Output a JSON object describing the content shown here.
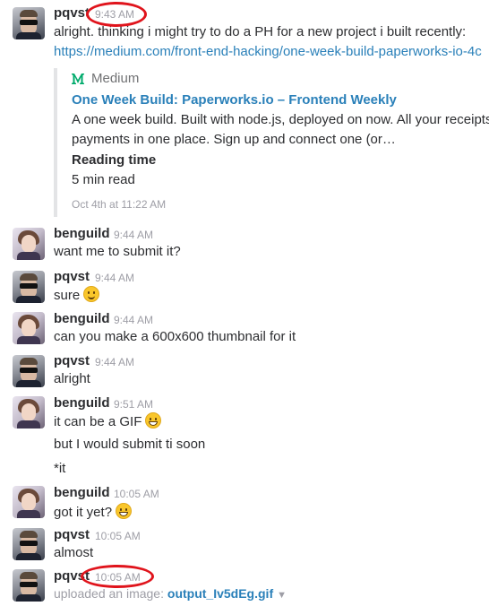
{
  "messages": [
    {
      "user": "pqvst",
      "time": "9:43 AM",
      "text": "alright. thinking i might try to do a PH for a new project i built recently:",
      "link": "https://medium.com/front-end-hacking/one-week-build-paperworks-io-4c",
      "attachment": {
        "provider": "Medium",
        "title": "One Week Build: Paperworks.io – Frontend Weekly",
        "desc_line1": "A one week build. Built with node.js, deployed on now. All your receipts,",
        "desc_line2": "payments in one place. Sign up and connect one (or…",
        "field_title": "Reading time",
        "field_value": "5 min read",
        "footer": "Oct 4th at 11:22 AM"
      }
    },
    {
      "user": "benguild",
      "time": "9:44 AM",
      "text": "want me to submit it?"
    },
    {
      "user": "pqvst",
      "time": "9:44 AM",
      "text": "sure",
      "emoji": "slightly-smiling-face"
    },
    {
      "user": "benguild",
      "time": "9:44 AM",
      "text": "can you make a 600x600 thumbnail for it"
    },
    {
      "user": "pqvst",
      "time": "9:44 AM",
      "text": "alright"
    },
    {
      "user": "benguild",
      "time": "9:51 AM",
      "text": "it can be a GIF",
      "emoji": "grinning-face",
      "followups": [
        "but I would submit ti soon",
        "*it"
      ]
    },
    {
      "user": "benguild",
      "time": "10:05 AM",
      "text": "got it yet?",
      "emoji": "grinning-face"
    },
    {
      "user": "pqvst",
      "time": "10:05 AM",
      "text": "almost"
    },
    {
      "user": "pqvst",
      "time": "10:05 AM",
      "upload_prefix": "uploaded an image:",
      "file_name": "output_Iv5dEg.gif"
    }
  ],
  "colors": {
    "link": "#2a80b9",
    "timestamp": "#9e9ea6",
    "highlight_ellipse": "#e0141c",
    "medium_brand": "#00ab6c"
  },
  "icons": {
    "emoji_smile": "slightly-smiling-face",
    "emoji_grin": "grinning-face",
    "provider": "medium-logo-icon",
    "dropdown": "caret-down-icon"
  }
}
